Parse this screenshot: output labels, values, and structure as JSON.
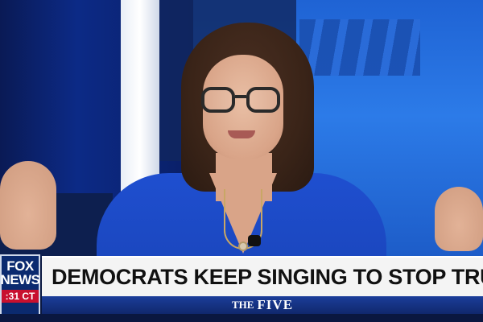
{
  "broadcast": {
    "network_logo": {
      "line1": "FOX",
      "line2": "NEWS",
      "clock": ":31 CT"
    },
    "headline": "DEMOCRATS KEEP SINGING TO STOP TRUMP",
    "show": {
      "prefix": "THE",
      "name": "FIVE"
    }
  },
  "colors": {
    "brand_blue": "#10286d",
    "accent_red": "#c8102e",
    "headline_bg": "#f4f4f4"
  }
}
